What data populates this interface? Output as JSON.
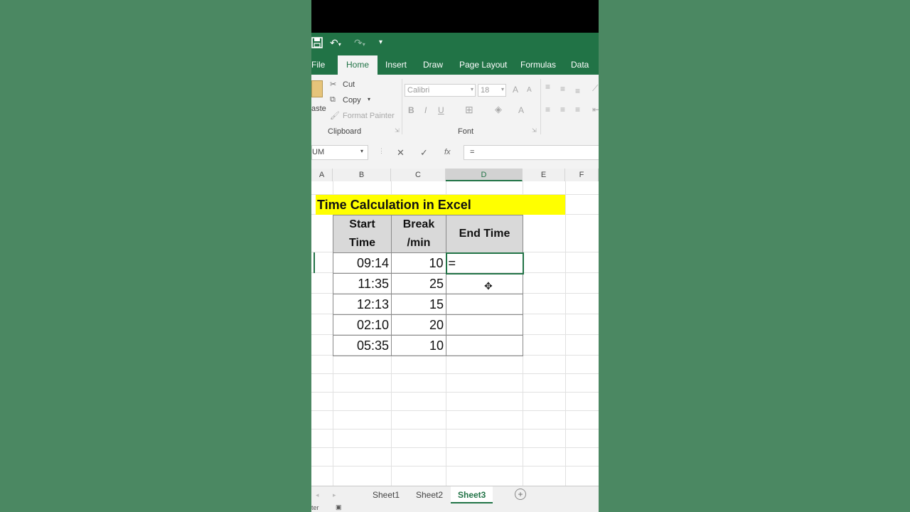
{
  "quick_access": {
    "save_icon": "save-icon",
    "undo_icon": "undo-icon",
    "redo_icon": "redo-icon",
    "customize_icon": "customize-icon"
  },
  "tabs": [
    "File",
    "Home",
    "Insert",
    "Draw",
    "Page Layout",
    "Formulas",
    "Data"
  ],
  "active_tab": "Home",
  "ribbon": {
    "clipboard": {
      "paste_label": "aste",
      "cut_label": "Cut",
      "copy_label": "Copy",
      "format_painter_label": "Format Painter",
      "group_label": "Clipboard"
    },
    "font": {
      "font_name": "Calibri",
      "font_size": "18",
      "bold": "B",
      "italic": "I",
      "underline": "U",
      "grow": "A",
      "shrink": "A",
      "font_color": "A",
      "group_label": "Font"
    }
  },
  "formula_bar": {
    "name_box": "UM",
    "cancel": "✕",
    "enter": "✓",
    "fx": "fx",
    "content": "="
  },
  "columns": [
    "A",
    "B",
    "C",
    "D",
    "E",
    "F"
  ],
  "selected_column": "D",
  "sheet": {
    "title": "Time Calculation in Excel",
    "headers": [
      [
        "Start",
        "Time"
      ],
      [
        "Break",
        "/min"
      ],
      [
        "End Time"
      ]
    ],
    "rows": [
      {
        "start": "09:14",
        "break": "10",
        "end": "="
      },
      {
        "start": "11:35",
        "break": "25",
        "end": ""
      },
      {
        "start": "12:13",
        "break": "15",
        "end": ""
      },
      {
        "start": "02:10",
        "break": "20",
        "end": ""
      },
      {
        "start": "05:35",
        "break": "10",
        "end": ""
      }
    ]
  },
  "sheet_tabs": [
    "Sheet1",
    "Sheet2",
    "Sheet3"
  ],
  "active_sheet": "Sheet3",
  "status_text": "ter",
  "colors": {
    "excel_green": "#217346",
    "title_highlight": "#ffff00",
    "header_fill": "#d9d9d9",
    "background": "#4c8a62"
  }
}
